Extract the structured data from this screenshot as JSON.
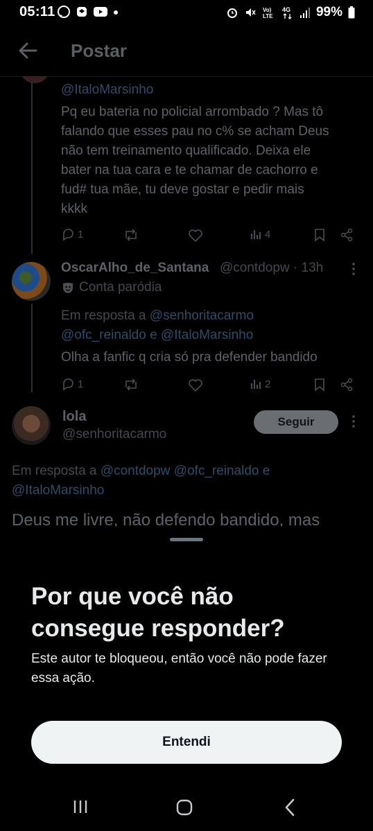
{
  "status_bar": {
    "time": "05:11",
    "battery": "99%",
    "network": "4G"
  },
  "header": {
    "title": "Postar"
  },
  "feed": {
    "tweet1": {
      "handle_link": "@ItaloMarsinho",
      "text_lines": [
        "Pq eu bateria no policial arrombado ? Mas tô",
        "falando que esses pau no c% se acham Deus",
        "não tem treinamento qualificado. Deixa ele",
        "bater na tua cara e te chamar de cachorro e",
        "fud# tua mãe, tu deve gostar e pedir mais",
        "kkkk"
      ],
      "replies": "1",
      "views": "4"
    },
    "tweet2": {
      "name": "OscarAlho_de_Santana",
      "handle_time": "@contdopw · 13h",
      "label": "Conta paródia",
      "reply_prefix": "Em resposta a",
      "reply_to_1": "@senhoritacarmo",
      "reply_to_2": "@ofc_reinaldo e @ItaloMarsinho",
      "text": "Olha a fanfic q cria só pra defender bandido",
      "replies": "1",
      "views": "2"
    },
    "tweet3": {
      "name": "lola",
      "handle": "@senhoritacarmo",
      "follow_label": "Seguir",
      "reply_prefix": "Em resposta a",
      "reply_to_1": "@contdopw @ofc_reinaldo e",
      "reply_to_2": "@ItaloMarsinho",
      "text": "Deus me livre, não defendo bandido, mas"
    }
  },
  "sheet": {
    "title": "Por que você não consegue responder?",
    "body": "Este autor te bloqueou, então você não pode fazer essa ação.",
    "button_label": "Entendi"
  },
  "colors": {
    "accent_link_dimmed": "#2e4d69",
    "button_bg": "#eff3f4",
    "background": "#000000"
  }
}
